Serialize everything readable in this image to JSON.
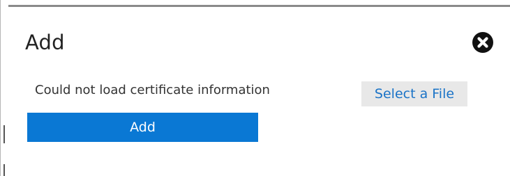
{
  "dialog": {
    "title": "Add",
    "close_icon": "close-icon",
    "message": "Could not load certificate information",
    "select_file_label": "Select a File",
    "add_button_label": "Add"
  },
  "colors": {
    "primary_button": "#0a78d4",
    "link": "#1a73c7",
    "secondary_button_bg": "#e8e8e8"
  }
}
